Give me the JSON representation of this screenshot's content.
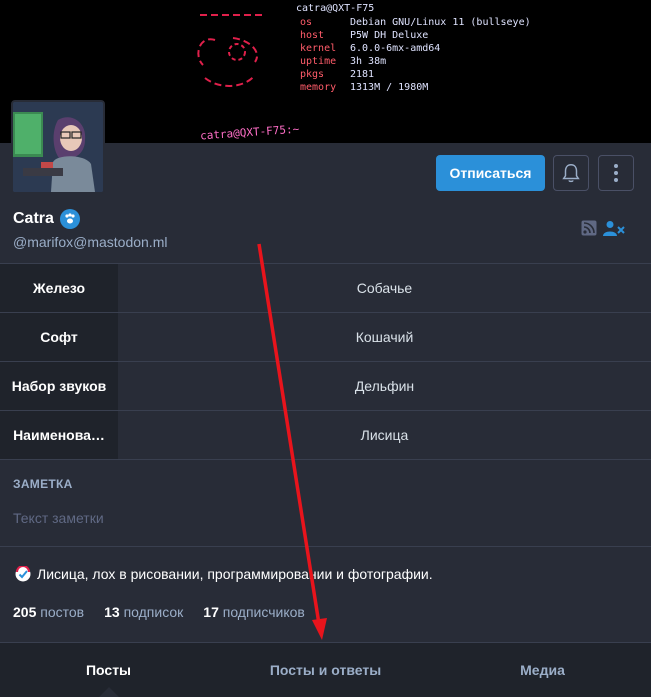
{
  "banner": {
    "term_head": "catra@QXT-F75",
    "term_rows": [
      {
        "key": "os",
        "val": "Debian GNU/Linux 11 (bullseye)"
      },
      {
        "key": "host",
        "val": "P5W DH Deluxe"
      },
      {
        "key": "kernel",
        "val": "6.0.0-6mx-amd64"
      },
      {
        "key": "uptime",
        "val": "3h 38m"
      },
      {
        "key": "pkgs",
        "val": "2181"
      },
      {
        "key": "memory",
        "val": "1313M / 1980M"
      }
    ],
    "prompt": "catra@QXT-F75:~"
  },
  "actions": {
    "unfollow_label": "Отписаться",
    "bell_icon": "bell-icon",
    "menu_icon": "ellipsis-vertical-icon"
  },
  "profile": {
    "display_name": "Catra",
    "handle": "@marifox@mastodon.ml",
    "accent": "#2b90d9"
  },
  "fields": [
    {
      "key": "Железо",
      "value": "Собачье"
    },
    {
      "key": "Софт",
      "value": "Кошачий"
    },
    {
      "key": "Набор звуков",
      "value": "Дельфин"
    },
    {
      "key": "Наименова…",
      "value": "Лисица"
    }
  ],
  "note": {
    "label": "ЗАМЕТКА",
    "placeholder": "Текст заметки"
  },
  "bio": "Лисица, лох в рисовании, программировании и фотографии.",
  "counters": [
    {
      "count": "205",
      "label": "постов"
    },
    {
      "count": "13",
      "label": "подписок"
    },
    {
      "count": "17",
      "label": "подписчиков"
    }
  ],
  "tabs": [
    {
      "label": "Посты",
      "active": true
    },
    {
      "label": "Посты и ответы",
      "active": false
    },
    {
      "label": "Медиа",
      "active": false
    }
  ]
}
